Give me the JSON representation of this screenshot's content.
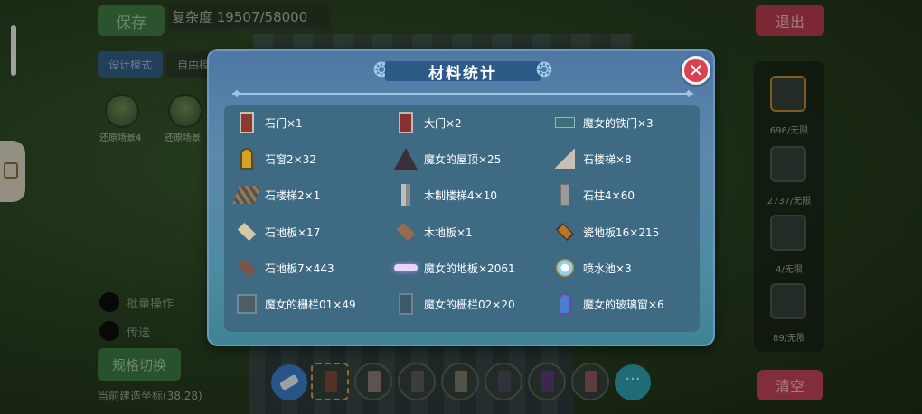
{
  "top_bar": {
    "save_label": "保存",
    "complexity_label": "复杂度 19507/58000",
    "exit_label": "退出"
  },
  "left_panel": {
    "design_mode_label": "设计模式",
    "free_mode_label": "自由模",
    "scenes": [
      {
        "label": "还原场景4"
      },
      {
        "label": "还原场景"
      }
    ],
    "bulk_op_label": "批量操作",
    "mode2_label": "传送",
    "switch_label": "规格切换",
    "coords_text": "当前建造坐标(38,28)"
  },
  "right_panel": {
    "items": [
      {
        "label": "696/无限"
      },
      {
        "label": "2737/无限"
      },
      {
        "label": "4/无限"
      },
      {
        "label": "89/无限"
      }
    ],
    "clear_label": "清空"
  },
  "hotbar": {
    "more_label": "···",
    "slot_colors": [
      "#7a4a3a",
      "#8a7a72",
      "#5a5a5a",
      "#7a7a6a",
      "#4a4a5a",
      "#5a3a7a",
      "#8a5a5a"
    ]
  },
  "modal": {
    "title": "材料统计",
    "close_icon": "close-icon",
    "items": [
      {
        "name": "石门×1",
        "icon": "stone-door-icon"
      },
      {
        "name": "大门×2",
        "icon": "big-door-icon"
      },
      {
        "name": "魔女的铁门×3",
        "icon": "witch-iron-door-icon"
      },
      {
        "name": "石窗2×32",
        "icon": "stone-window-icon"
      },
      {
        "name": "魔女的屋顶×25",
        "icon": "witch-roof-icon"
      },
      {
        "name": "石楼梯×8",
        "icon": "stone-stairs-icon"
      },
      {
        "name": "石楼梯2×1",
        "icon": "stone-stairs2-icon"
      },
      {
        "name": "木制楼梯4×10",
        "icon": "wood-stairs-icon"
      },
      {
        "name": "石柱4×60",
        "icon": "stone-pillar-icon"
      },
      {
        "name": "石地板×17",
        "icon": "stone-floor-icon"
      },
      {
        "name": "木地板×1",
        "icon": "wood-floor-icon"
      },
      {
        "name": "瓷地板16×215",
        "icon": "tile-floor-icon"
      },
      {
        "name": "石地板7×443",
        "icon": "stone-floor7-icon"
      },
      {
        "name": "魔女的地板×2061",
        "icon": "witch-floor-icon"
      },
      {
        "name": "喷水池×3",
        "icon": "fountain-icon"
      },
      {
        "name": "魔女的栅栏01×49",
        "icon": "witch-fence01-icon"
      },
      {
        "name": "魔女的栅栏02×20",
        "icon": "witch-fence02-icon"
      },
      {
        "name": "魔女的玻璃窗×6",
        "icon": "witch-glass-window-icon"
      }
    ]
  }
}
